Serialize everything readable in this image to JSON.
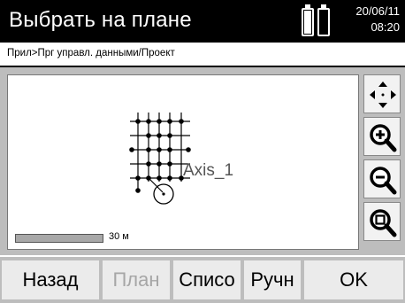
{
  "header": {
    "title": "Выбрать на плане",
    "date": "20/06/11",
    "time": "08:20",
    "battery_icon": "battery-icon"
  },
  "breadcrumb": "Прил>Прг управл. данными/Проект",
  "map": {
    "axis_label": "Axis_1",
    "scale_label": "30 м"
  },
  "side_buttons": [
    "pan-icon",
    "zoom-in-icon",
    "zoom-out-icon",
    "zoom-fit-icon"
  ],
  "softkeys": [
    {
      "label": "Назад",
      "enabled": true
    },
    {
      "label": "План",
      "enabled": false
    },
    {
      "label": "Списо",
      "enabled": true
    },
    {
      "label": "Ручн",
      "enabled": true
    },
    {
      "label": "OK",
      "enabled": true
    }
  ]
}
